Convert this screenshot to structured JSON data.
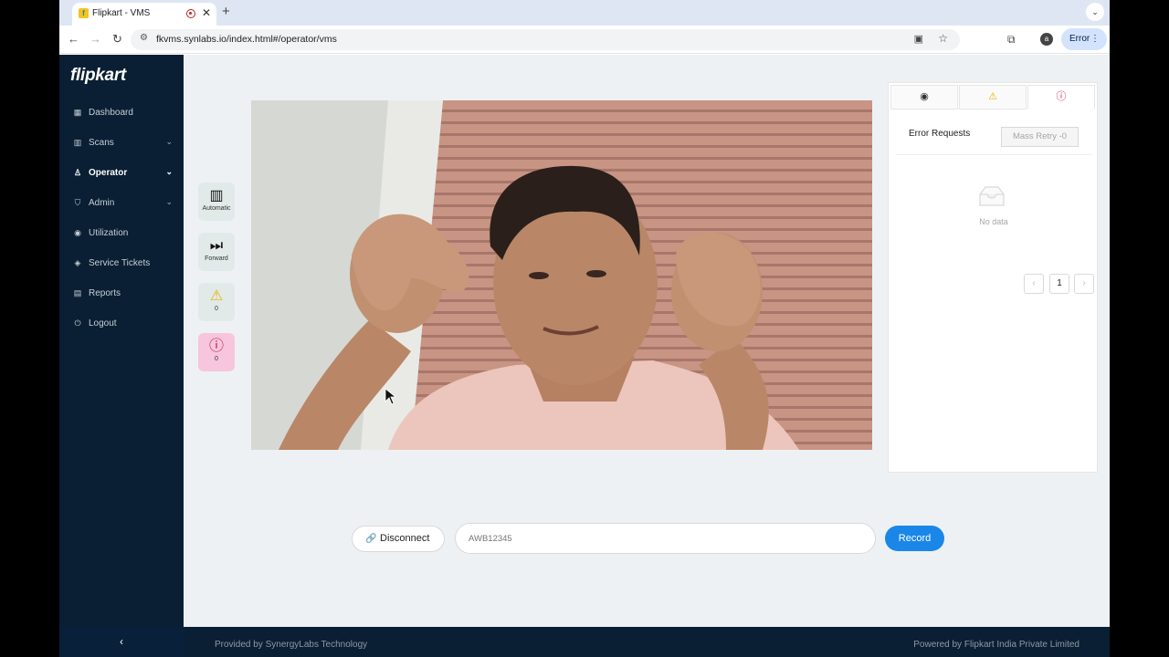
{
  "browser": {
    "tab_title": "Flipkart - VMS",
    "url": "fkvms.synlabs.io/index.html#/operator/vms",
    "profile_initial": "a",
    "status_pill": "Error"
  },
  "sidebar": {
    "logo": "flipkart",
    "items": [
      {
        "label": "Dashboard",
        "icon": "grid-icon"
      },
      {
        "label": "Scans",
        "icon": "barcode-icon",
        "expandable": true
      },
      {
        "label": "Operator",
        "icon": "user-icon",
        "expandable": true,
        "active": true
      },
      {
        "label": "Admin",
        "icon": "shield-icon",
        "expandable": true
      },
      {
        "label": "Utilization",
        "icon": "signal-icon"
      },
      {
        "label": "Service Tickets",
        "icon": "tag-icon"
      },
      {
        "label": "Reports",
        "icon": "file-icon"
      },
      {
        "label": "Logout",
        "icon": "power-icon"
      }
    ]
  },
  "controls": [
    {
      "label": "Automatic",
      "icon": "barcode-icon"
    },
    {
      "label": "Forward",
      "icon": "fast-forward-icon"
    },
    {
      "label": "0",
      "icon": "warning-icon"
    },
    {
      "label": "0",
      "icon": "error-icon"
    }
  ],
  "panel": {
    "title": "Error Requests",
    "mass_retry": "Mass Retry -0",
    "empty_text": "No data",
    "current_page": "1"
  },
  "bottom_bar": {
    "disconnect_label": "Disconnect",
    "awb_placeholder": "AWB12345",
    "record_label": "Record"
  },
  "footer": {
    "left": "Provided by SynergyLabs Technology",
    "right": "Powered by Flipkart India Private Limited"
  },
  "colors": {
    "sidebar_bg": "#0a1f33",
    "main_bg": "#eef1f4",
    "primary": "#1a87e8",
    "warning": "#e8b000",
    "error": "#c0143c"
  }
}
